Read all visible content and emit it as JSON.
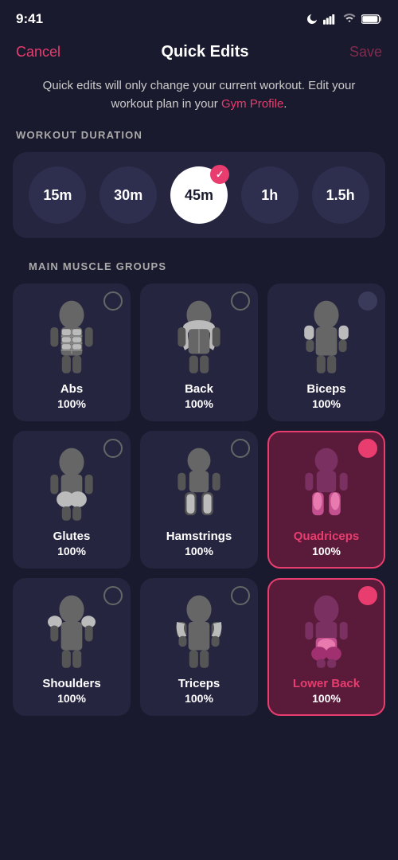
{
  "statusBar": {
    "time": "9:41",
    "moonIcon": "moon",
    "signalIcon": "signal",
    "wifiIcon": "wifi",
    "batteryIcon": "battery"
  },
  "nav": {
    "cancelLabel": "Cancel",
    "title": "Quick Edits",
    "saveLabel": "Save"
  },
  "infoText": {
    "main": "Quick edits will only change your current workout. Edit your workout plan in your ",
    "link": "Gym Profile",
    "end": "."
  },
  "workoutDuration": {
    "sectionLabel": "WORKOUT DURATION",
    "options": [
      "15m",
      "30m",
      "45m",
      "1h",
      "1.5h"
    ],
    "selectedIndex": 2
  },
  "muscleGroups": {
    "sectionLabel": "MAIN MUSCLE GROUPS",
    "muscles": [
      {
        "name": "Abs",
        "pct": "100%",
        "selected": false,
        "highlight": false
      },
      {
        "name": "Back",
        "pct": "100%",
        "selected": false,
        "highlight": false
      },
      {
        "name": "Biceps",
        "pct": "100%",
        "selected": false,
        "highlight": false
      },
      {
        "name": "Glutes",
        "pct": "100%",
        "selected": false,
        "highlight": false
      },
      {
        "name": "Hamstrings",
        "pct": "100%",
        "selected": false,
        "highlight": false
      },
      {
        "name": "Quadriceps",
        "pct": "100%",
        "selected": true,
        "highlight": true
      },
      {
        "name": "Shoulders",
        "pct": "100%",
        "selected": false,
        "highlight": false
      },
      {
        "name": "Triceps",
        "pct": "100%",
        "selected": false,
        "highlight": false
      },
      {
        "name": "Lower Back",
        "pct": "100%",
        "selected": true,
        "highlight": true
      }
    ]
  }
}
